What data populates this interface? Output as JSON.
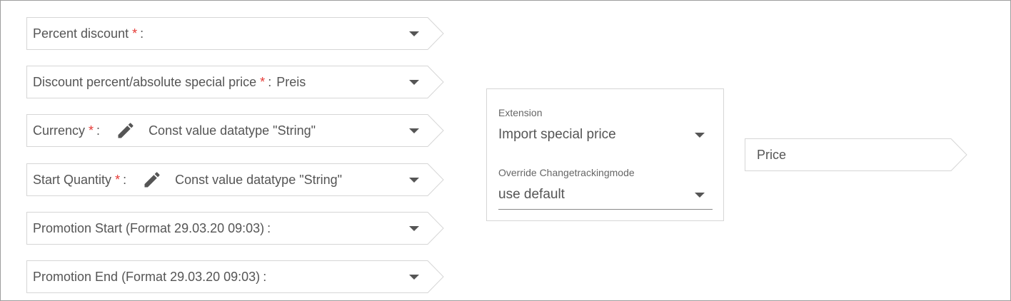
{
  "fields": [
    {
      "label": "Percent discount",
      "required": true,
      "value": "",
      "edit_icon": false
    },
    {
      "label": "Discount percent/absolute special price",
      "required": true,
      "value": "Preis",
      "edit_icon": false
    },
    {
      "label": "Currency",
      "required": true,
      "value": "Const value datatype \"String\"",
      "edit_icon": true
    },
    {
      "label": "Start Quantity",
      "required": true,
      "value": "Const value datatype \"String\"",
      "edit_icon": true
    },
    {
      "label": "Promotion Start (Format 29.03.20 09:03)",
      "required": false,
      "value": "",
      "edit_icon": false
    },
    {
      "label": "Promotion End (Format 29.03.20 09:03)",
      "required": false,
      "value": "",
      "edit_icon": false
    }
  ],
  "required_marker": "*",
  "colon": ":",
  "extension_panel": {
    "extension_label": "Extension",
    "extension_value": "Import special price",
    "override_label": "Override Changetrackingmode",
    "override_value": "use default"
  },
  "target": {
    "label": "Price"
  },
  "icons": {
    "edit": "pencil-icon",
    "dropdown": "caret-down-icon"
  },
  "colors": {
    "required": "#e53935",
    "border": "#d6d6d6",
    "text": "#555555"
  }
}
